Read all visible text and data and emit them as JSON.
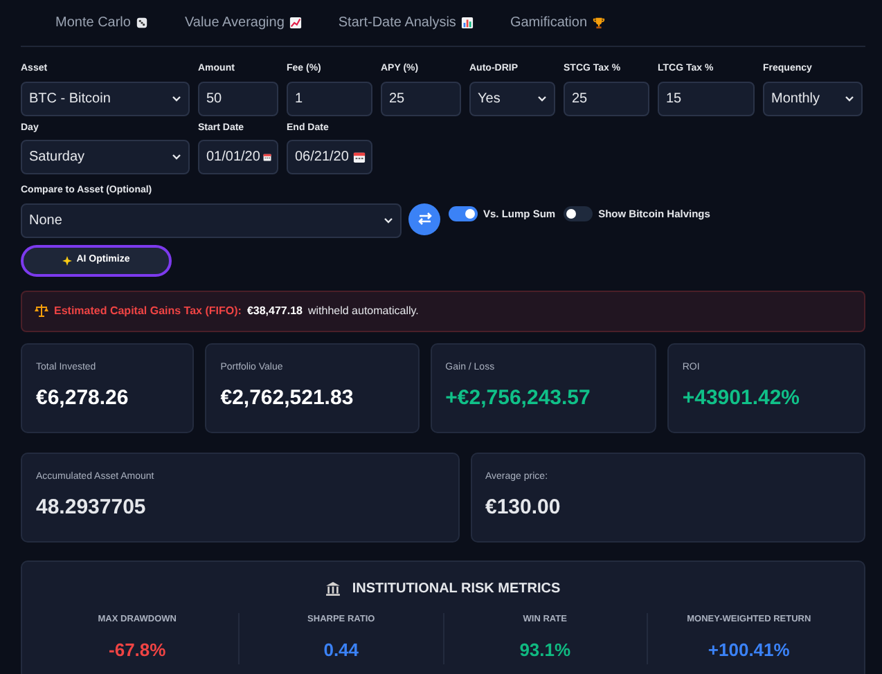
{
  "tabs": [
    {
      "label": "Monte Carlo",
      "selected": false
    },
    {
      "label": "Value Averaging",
      "selected": false
    },
    {
      "label": "Start-Date Analysis",
      "selected": false
    },
    {
      "label": "Gamification",
      "selected": false
    }
  ],
  "fields": [
    {
      "label": "Asset",
      "kind": "select",
      "value": "BTC - Bitcoin"
    },
    {
      "label": "Amount",
      "kind": "input",
      "value": "50"
    },
    {
      "label": "Fee (%)",
      "kind": "input",
      "value": "1"
    },
    {
      "label": "APY (%)",
      "kind": "input",
      "value": "25"
    },
    {
      "label": "Auto-DRIP",
      "kind": "select",
      "value": "Yes"
    },
    {
      "label": "STCG Tax %",
      "kind": "input",
      "value": "25"
    },
    {
      "label": "LTCG Tax %",
      "kind": "input",
      "value": "15"
    },
    {
      "label": "Frequency",
      "kind": "select",
      "value": "Monthly"
    },
    {
      "label": "Day",
      "kind": "select",
      "value": "Saturday"
    },
    {
      "label": "Start Date",
      "kind": "date",
      "value": "01/01/20"
    },
    {
      "label": "End Date",
      "kind": "date",
      "value": "06/21/20"
    }
  ],
  "compare": {
    "label": "Compare to Asset (Optional)",
    "value": "None"
  },
  "toggles": [
    {
      "label": "Vs. Lump Sum",
      "on": true
    },
    {
      "label": "Show Bitcoin Halvings",
      "on": false
    }
  ],
  "optimize_button": "AI Optimize",
  "tax_alert": {
    "label": "Estimated Capital Gains Tax (FIFO):",
    "amount": "€38,477.18",
    "text": "withheld automatically."
  },
  "stats": [
    {
      "label": "Total Invested",
      "value": "€6,278.26",
      "color": "#ffffff"
    },
    {
      "label": "Portfolio Value",
      "value": "€2,762,521.83",
      "color": "#ffffff"
    },
    {
      "label": "Gain / Loss",
      "value": "+€2,756,243.57",
      "color": "#10c088"
    },
    {
      "label": "ROI",
      "value": "+43901.42%",
      "color": "#10c088"
    }
  ],
  "summary": [
    {
      "label": "Accumulated Asset Amount",
      "value": "48.2937705"
    },
    {
      "label": "Average price:",
      "value": "€130.00"
    }
  ],
  "risk": {
    "title": "INSTITUTIONAL RISK METRICS",
    "metrics": [
      {
        "label": "MAX DRAWDOWN",
        "value": "-67.8%",
        "color": "#ef4444"
      },
      {
        "label": "SHARPE RATIO",
        "value": "0.44",
        "color": "#3b82f6"
      },
      {
        "label": "WIN RATE",
        "value": "93.1%",
        "color": "#10b981"
      },
      {
        "label": "MONEY-WEIGHTED RETURN",
        "value": "+100.41%",
        "color": "#3b82f6"
      }
    ]
  }
}
